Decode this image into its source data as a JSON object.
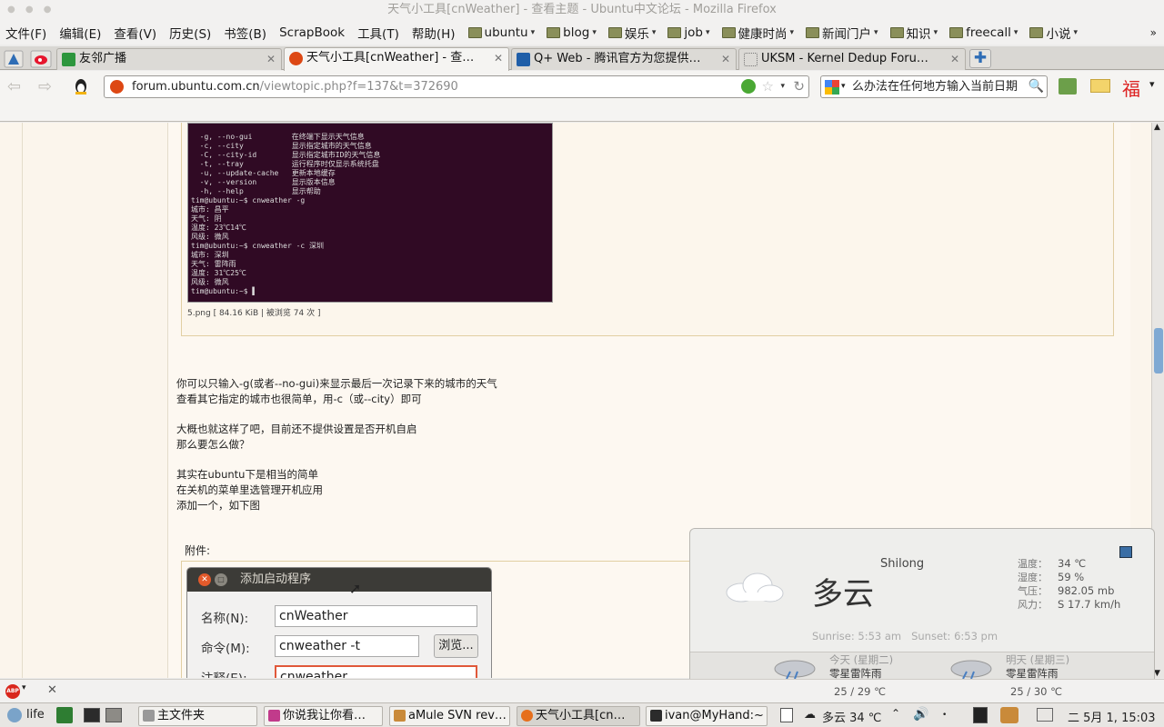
{
  "window": {
    "title": "天气小工具[cnWeather] - 查看主题 - Ubuntu中文论坛 - Mozilla Firefox"
  },
  "menu": [
    "文件(F)",
    "编辑(E)",
    "查看(V)",
    "历史(S)",
    "书签(B)",
    "ScrapBook",
    "工具(T)",
    "帮助(H)"
  ],
  "bookmarks": [
    "ubuntu",
    "blog",
    "娱乐",
    "job",
    "健康时尚",
    "新闻门户",
    "知识",
    "freecall",
    "小说"
  ],
  "tabs": [
    {
      "label": "友邻广播",
      "active": false
    },
    {
      "label": "天气小工具[cnWeather] - 查…",
      "active": true
    },
    {
      "label": "Q+ Web - 腾讯官方为您提供…",
      "active": false
    },
    {
      "label": "UKSM - Kernel Dedup Foru…",
      "active": false
    }
  ],
  "url": {
    "host": "forum.ubuntu.com.cn",
    "path": "/viewtopic.php?f=137&t=372690"
  },
  "search": {
    "value": "么办法在任何地方输入当前日期"
  },
  "terminal_lines": [
    "  -g, --no-gui         在终端下显示天气信息",
    "  -c, --city           显示指定城市的天气信息",
    "  -C, --city-id        显示指定城市ID的天气信息",
    "  -t, --tray           运行程序时仅显示系统托盘",
    "  -u, --update-cache   更新本地缓存",
    "  -v, --version        显示版本信息",
    "  -h, --help           显示帮助",
    "tim@ubuntu:~$ cnweather -g",
    "城市: 昌平",
    "天气: 阴",
    "温度: 23℃14℃",
    "风级: 微风",
    "tim@ubuntu:~$ cnweather -c 深圳",
    "城市: 深圳",
    "天气: 雷阵雨",
    "温度: 31℃25℃",
    "风级: 微风",
    "tim@ubuntu:~$ ▌"
  ],
  "attachment1_caption": "5.png [ 84.16 KiB | 被浏览 74 次 ]",
  "paragraphs": [
    [
      "你可以只输入-g(或者--no-gui)来显示最后一次记录下来的城市的天气",
      "查看其它指定的城市也很简单，用-c（或--city）即可"
    ],
    [
      "大概也就这样了吧，目前还不提供设置是否开机自启",
      "那么要怎么做？"
    ],
    [
      "其实在ubuntu下是相当的简单",
      "在关机的菜单里选管理开机应用",
      "添加一个，如下图"
    ]
  ],
  "attachment_label": "附件:",
  "dialog": {
    "title": "添加启动程序",
    "name_label": "名称(N):",
    "name_value": "cnWeather",
    "command_label": "命令(M):",
    "command_value": "cnweather -t",
    "browse_label": "浏览...",
    "comment_label": "注释(E):",
    "comment_value": "cnweather"
  },
  "weather": {
    "condition": "多云",
    "city": "Shilong",
    "details": [
      {
        "label": "温度：",
        "value": "34 ℃"
      },
      {
        "label": "湿度：",
        "value": "59 %"
      },
      {
        "label": "气压：",
        "value": "982.05 mb"
      },
      {
        "label": "风力：",
        "value": "S 17.7 km/h"
      }
    ],
    "sun": "Sunrise: 5:53 am   Sunset: 6:53 pm",
    "forecast": [
      {
        "day": "今天 (星期二)",
        "condition": "零星雷阵雨",
        "temp": "25 / 29 ℃"
      },
      {
        "day": "明天 (星期三)",
        "condition": "零星雷阵雨",
        "temp": "25 / 30 ℃"
      }
    ]
  },
  "taskbar": {
    "start": "life",
    "tasks": [
      {
        "label": "主文件夹",
        "active": false
      },
      {
        "label": "你说我让你看…",
        "active": false
      },
      {
        "label": "aMule SVN rev…",
        "active": false
      },
      {
        "label": "天气小工具[cn…",
        "active": true
      },
      {
        "label": "ivan@MyHand:~",
        "active": false
      }
    ],
    "tray_weather": "多云 34 ℃",
    "clock": "二 5月 1, 15:03"
  },
  "colors": {
    "terminal_bg": "#300a24",
    "post_bg": "#fdf8f1",
    "accent": "#dd4814"
  }
}
